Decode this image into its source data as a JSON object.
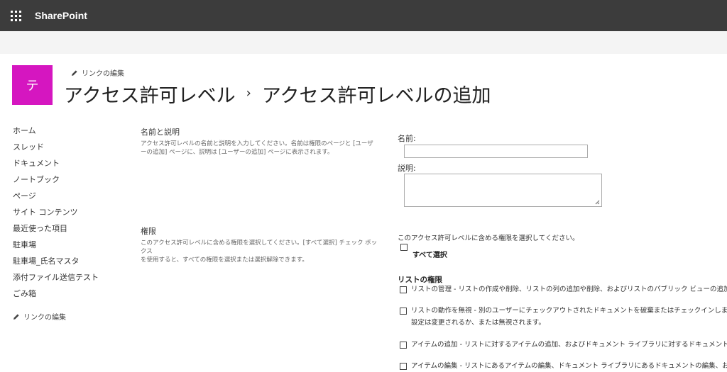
{
  "suite_bar": {
    "brand": "SharePoint",
    "app_launcher": "waffle-icon"
  },
  "site": {
    "logo_letter": "テ",
    "logo_color": "#d516c0"
  },
  "edit_links_label": "リンクの編集",
  "breadcrumb": {
    "parent": "アクセス許可レベル",
    "separator": "›",
    "current": "アクセス許可レベルの追加"
  },
  "quick_launch": [
    {
      "label": "ホーム"
    },
    {
      "label": "スレッド"
    },
    {
      "label": "ドキュメント"
    },
    {
      "label": "ノートブック"
    },
    {
      "label": "ページ"
    },
    {
      "label": "サイト コンテンツ"
    },
    {
      "label": "最近使った項目"
    },
    {
      "label": "駐車場"
    },
    {
      "label": "駐車場_氏名マスタ"
    },
    {
      "label": "添付ファイル送信テスト"
    },
    {
      "label": "ごみ箱"
    }
  ],
  "name_section": {
    "title": "名前と説明",
    "desc_line1": "アクセス許可レベルの名前と説明を入力してください。名前は権限のページと [ユーザ",
    "desc_line2": "ーの追加] ページに、説明は [ユーザーの追加] ページに表示されます。",
    "name_label": "名前:",
    "name_value": "",
    "description_label": "説明:",
    "description_value": ""
  },
  "permissions_section": {
    "title": "権限",
    "desc_line1": "このアクセス許可レベルに含める権限を選択してください。[すべて選択] チェック ボックス",
    "desc_line2": "を使用すると、すべての権限を選択または選択解除できます。",
    "intro": "このアクセス許可レベルに含める権限を選択してください。",
    "select_all_label": "すべて選択",
    "group_title": "リストの権限",
    "items": [
      {
        "name": "リストの管理",
        "sep": " - ",
        "description": "リストの作成や削除、リストの列の追加や削除、およびリストのパブリック ビューの追加",
        "checked": false
      },
      {
        "name": "リストの動作を無視",
        "sep": " - ",
        "description": "別のユーザーにチェックアウトされたドキュメントを破棄またはチェックインします。",
        "description2": "設定は変更されるか、または無視されます。",
        "checked": false
      },
      {
        "name": "アイテムの追加",
        "sep": " - ",
        "description": "リストに対するアイテムの追加、およびドキュメント ライブラリに対するドキュメントの追",
        "checked": false
      },
      {
        "name": "アイテムの編集",
        "sep": " - ",
        "description": "リストにあるアイテムの編集、ドキュメント ライブラリにあるドキュメントの編集、およ",
        "checked": false
      }
    ]
  }
}
